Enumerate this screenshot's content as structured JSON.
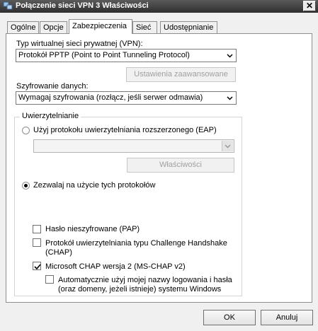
{
  "window": {
    "title": "Połączenie sieci VPN 3 Właściwości",
    "close_glyph": "✕"
  },
  "tabs": [
    {
      "label": "Ogólne"
    },
    {
      "label": "Opcje"
    },
    {
      "label": "Zabezpieczenia"
    },
    {
      "label": "Sieć"
    },
    {
      "label": "Udostępnianie"
    }
  ],
  "active_tab": "Zabezpieczenia",
  "vpn_type": {
    "label": "Typ wirtualnej sieci prywatnej (VPN):",
    "value": "Protokół PPTP (Point to Point Tunneling Protocol)"
  },
  "advanced_button": "Ustawienia zaawansowane",
  "encryption": {
    "label": "Szyfrowanie danych:",
    "value": "Wymagaj szyfrowania (rozłącz, jeśli serwer odmawia)"
  },
  "auth": {
    "legend": "Uwierzytelnianie",
    "eap_radio": "Użyj protokołu uwierzytelniania rozszerzonego (EAP)",
    "eap_select_value": "",
    "properties_button": "Właściwości",
    "allow_radio": "Zezwalaj na użycie tych protokołów",
    "selected": "allow"
  },
  "protocols": [
    {
      "label": "Hasło nieszyfrowane (PAP)",
      "checked": false
    },
    {
      "label_line1": "Protokół uwierzytelniania typu Challenge Handshake",
      "label_line2": "(CHAP)",
      "checked": false
    },
    {
      "label": "Microsoft CHAP wersja 2 (MS-CHAP v2)",
      "checked": true
    }
  ],
  "auto_logon": {
    "line1": "Automatycznie użyj mojej nazwy logowania i hasła",
    "line2": "(oraz domeny, jeżeli istnieje) systemu Windows",
    "checked": false
  },
  "footer": {
    "ok": "OK",
    "cancel": "Anuluj"
  }
}
